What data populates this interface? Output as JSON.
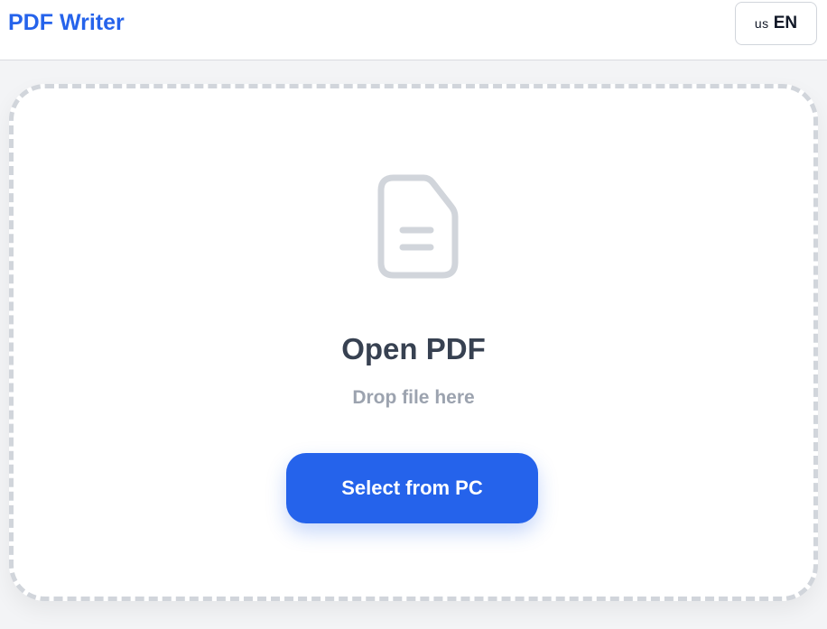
{
  "header": {
    "brand": "PDF Writer",
    "language": {
      "flag": "us",
      "code": "EN"
    }
  },
  "dropzone": {
    "icon": "file-text-icon",
    "title": "Open PDF",
    "subtitle": "Drop file here",
    "button_label": "Select from PC"
  },
  "colors": {
    "accent": "#2563eb",
    "icon": "#d1d5db",
    "title": "#374151",
    "subtitle": "#9ca3af",
    "page_bg": "#f3f4f6"
  }
}
